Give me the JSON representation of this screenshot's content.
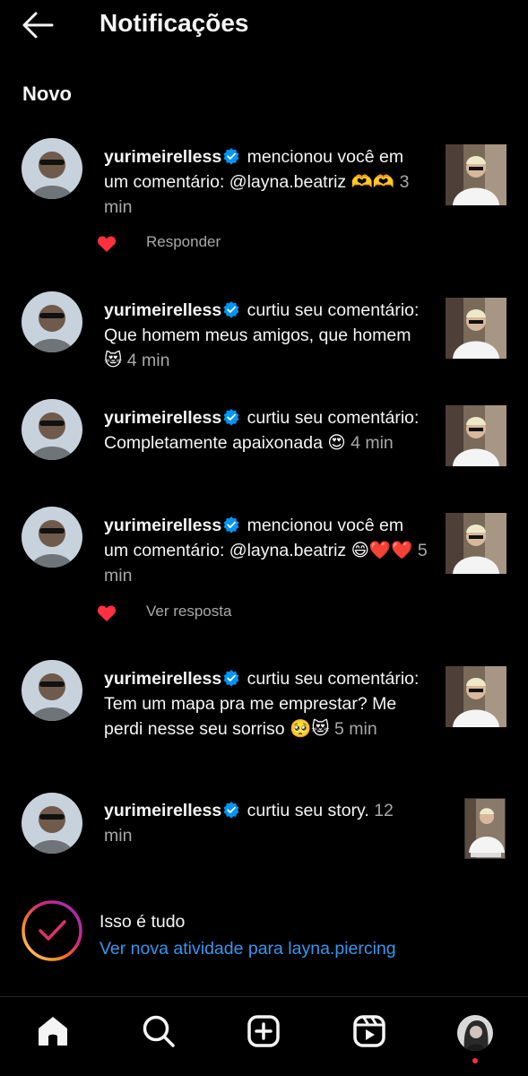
{
  "header": {
    "title": "Notificações",
    "back_icon": "arrow-left-icon"
  },
  "section": {
    "title": "Novo"
  },
  "notifications": [
    {
      "username": "yurimeirelless",
      "text": "mencionou você em um comentário: @layna.beatriz 🫶🫶",
      "time": "3 min",
      "action": "Responder",
      "liked": true
    },
    {
      "username": "yurimeirelless",
      "text": "curtiu seu comentário: Que homem meus amigos, que homem 😻",
      "time": "4 min"
    },
    {
      "username": "yurimeirelless",
      "text": "curtiu seu comentário: Completamente apaixonada 😍",
      "time": "4 min"
    },
    {
      "username": "yurimeirelless",
      "text": "mencionou você em um comentário: @layna.beatriz 😄❤️❤️",
      "time": "5 min",
      "action": "Ver resposta",
      "liked": true
    },
    {
      "username": "yurimeirelless",
      "text": "curtiu seu comentário: Tem um mapa pra me emprestar? Me perdi nesse seu sorriso 🥺😻",
      "time": "5 min"
    },
    {
      "username": "yurimeirelless",
      "text": "curtiu seu story.",
      "time": "12 min"
    }
  ],
  "caught_up": {
    "title": "Isso é tudo",
    "link": "Ver nova atividade para layna.piercing"
  },
  "nav": {
    "items": [
      "home-icon",
      "search-icon",
      "new-post-icon",
      "reels-icon",
      "profile-avatar"
    ]
  },
  "colors": {
    "background": "#000000",
    "text": "#f5f5f5",
    "secondary": "#a8a8a8",
    "link": "#3797f0",
    "like": "#ff3040",
    "verified": "#0095f6"
  }
}
